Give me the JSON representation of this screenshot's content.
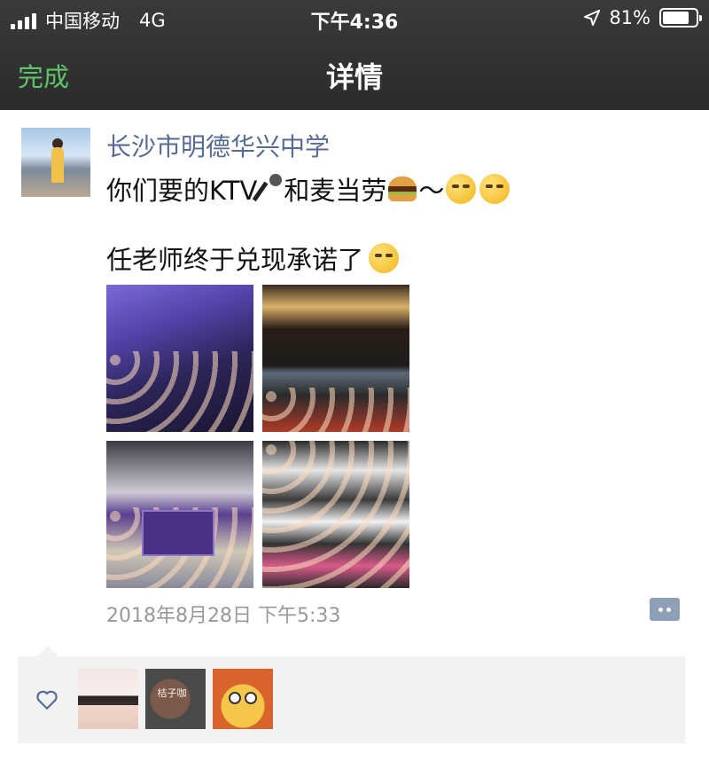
{
  "status_bar": {
    "carrier": "中国移动",
    "network": "4G",
    "time": "下午4:36",
    "battery": "81%",
    "battery_level": 0.81,
    "icons": [
      "signal-icon",
      "location-arrow-icon",
      "battery-icon"
    ]
  },
  "nav": {
    "done_label": "完成",
    "title": "详情"
  },
  "post": {
    "author": "长沙市明德华兴中学",
    "text_line1_a": "你们要的KTV",
    "text_line1_b": "和麦当劳",
    "text_line1_c": "～",
    "text_line2": "任老师终于兑现承诺了",
    "timestamp": "2018年8月28日 下午5:33",
    "photos": [
      "ktv-group-photo",
      "mcdonalds-photo",
      "gym-group-banner-photo",
      "graduation-crowd-photo"
    ]
  },
  "likes": {
    "liker_sign_text": "桔子咖"
  },
  "colors": {
    "header_bg": "#2b2b2b",
    "done_green": "#5cc66a",
    "link_blue": "#576b95",
    "timestamp_gray": "#999999",
    "likes_bg": "#f2f2f2"
  }
}
